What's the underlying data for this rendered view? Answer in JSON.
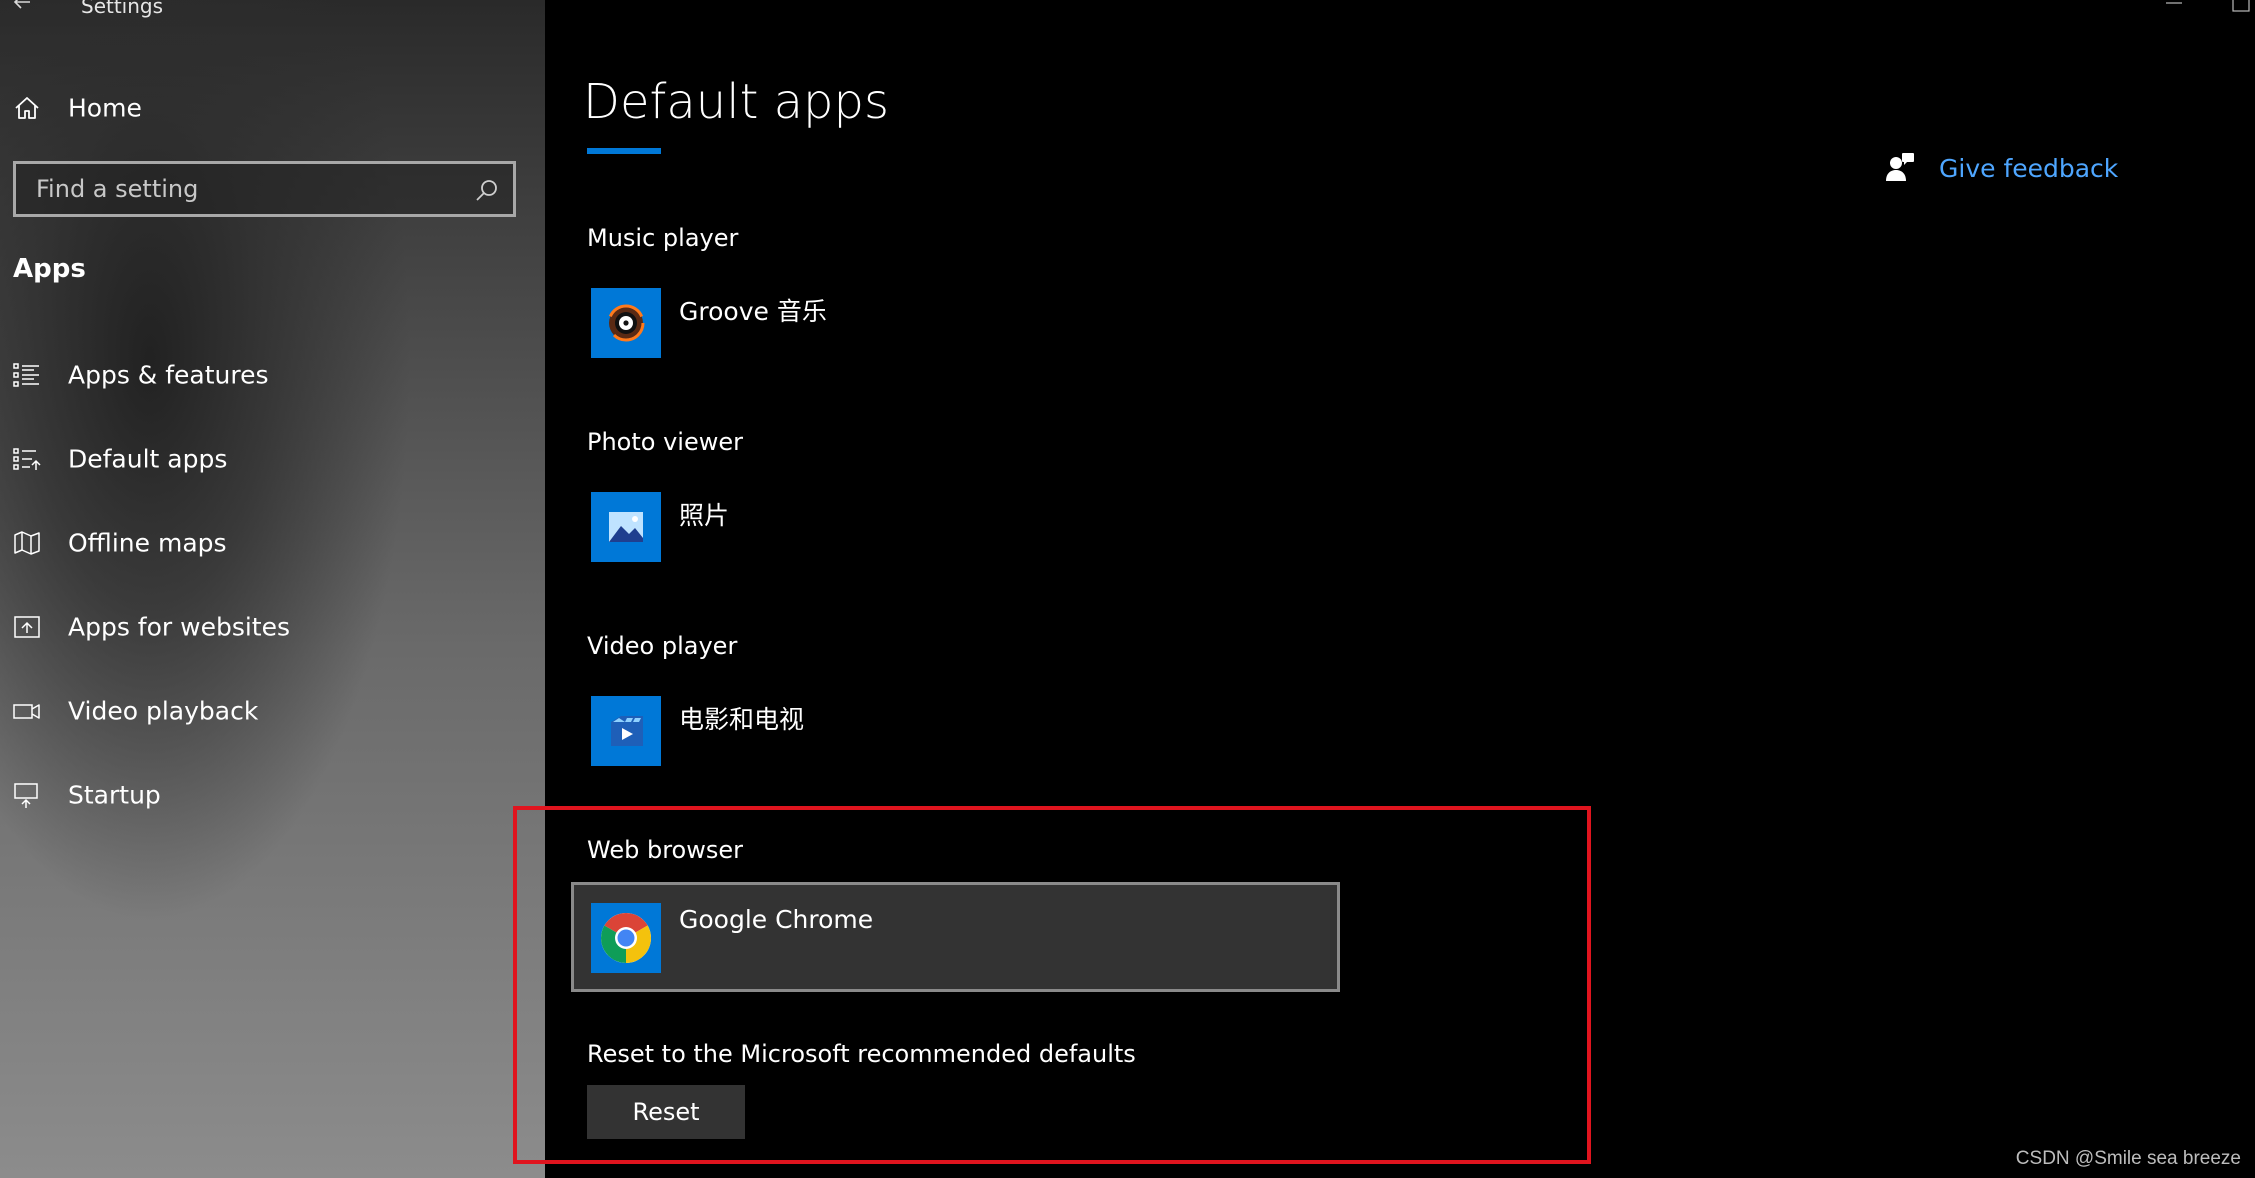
{
  "window": {
    "title": "Settings"
  },
  "sidebar": {
    "home_label": "Home",
    "search": {
      "placeholder": "Find a setting",
      "value": ""
    },
    "section_title": "Apps",
    "items": [
      {
        "label": "Apps & features",
        "icon": "list-icon"
      },
      {
        "label": "Default apps",
        "icon": "default-apps-icon"
      },
      {
        "label": "Offline maps",
        "icon": "map-icon"
      },
      {
        "label": "Apps for websites",
        "icon": "open-in-app-icon"
      },
      {
        "label": "Video playback",
        "icon": "video-camera-icon"
      },
      {
        "label": "Startup",
        "icon": "startup-icon"
      }
    ]
  },
  "main": {
    "page_title": "Default apps",
    "feedback_label": "Give feedback",
    "categories": [
      {
        "label": "Music player",
        "app": "Groove 音乐",
        "icon": "groove-music-icon"
      },
      {
        "label": "Photo viewer",
        "app": "照片",
        "icon": "photos-icon"
      },
      {
        "label": "Video player",
        "app": "电影和电视",
        "icon": "movies-tv-icon"
      },
      {
        "label": "Web browser",
        "app": "Google Chrome",
        "icon": "chrome-icon"
      }
    ],
    "reset": {
      "label": "Reset to the Microsoft recommended defaults",
      "button": "Reset"
    }
  },
  "colors": {
    "accent": "#0078d7",
    "link": "#4ea6ff",
    "highlight": "#e0141e"
  },
  "watermark": "CSDN @Smile sea breeze"
}
